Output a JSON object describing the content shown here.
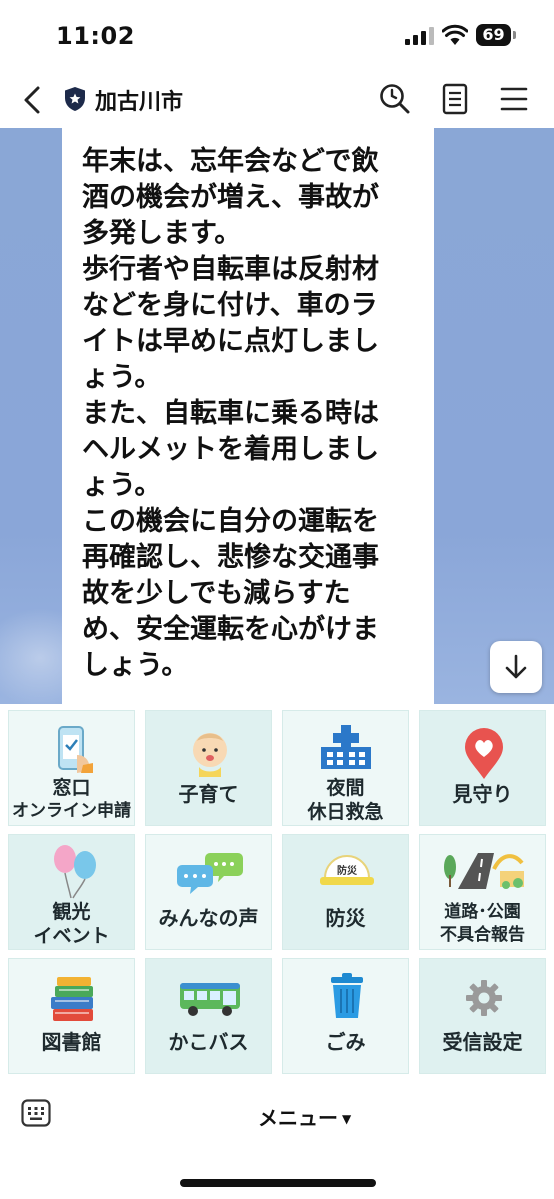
{
  "status_bar": {
    "time": "11:02",
    "battery": "69"
  },
  "header": {
    "title": "加古川市"
  },
  "chat": {
    "message_lines": [
      "年末は、忘年会などで飲",
      "酒の機会が増え、事故が",
      "多発します。",
      "歩行者や自転車は反射材",
      "などを身に付け、車のラ",
      "イトは早めに点灯しまし",
      "ょう。",
      "また、自転車に乗る時は",
      "ヘルメットを着用しまし",
      "ょう。",
      "この機会に自分の運転を",
      "再確認し、悲惨な交通事",
      "故を少しでも減らすた",
      "め、安全運転を心がけま",
      "しょう。"
    ]
  },
  "rich_menu": {
    "items": [
      {
        "lines": [
          "窓口",
          "オンライン申請"
        ],
        "icon": "phone-checklist-icon"
      },
      {
        "lines": [
          "子育て"
        ],
        "icon": "baby-icon"
      },
      {
        "lines": [
          "夜間",
          "休日救急"
        ],
        "icon": "hospital-icon"
      },
      {
        "lines": [
          "見守り"
        ],
        "icon": "heart-pin-icon"
      },
      {
        "lines": [
          "観光",
          "イベント"
        ],
        "icon": "balloons-icon"
      },
      {
        "lines": [
          "みんなの声"
        ],
        "icon": "speech-bubbles-icon"
      },
      {
        "lines": [
          "防災"
        ],
        "icon": "helmet-icon"
      },
      {
        "lines": [
          "道路･公園",
          "不具合報告"
        ],
        "icon": "road-park-icon"
      },
      {
        "lines": [
          "図書館"
        ],
        "icon": "books-icon"
      },
      {
        "lines": [
          "かこバス"
        ],
        "icon": "bus-icon"
      },
      {
        "lines": [
          "ごみ"
        ],
        "icon": "trash-bin-icon"
      },
      {
        "lines": [
          "受信設定"
        ],
        "icon": "gear-icon"
      }
    ]
  },
  "helmet_text": "防災",
  "bottom_bar": {
    "menu_label": "メニュー"
  },
  "colors": {
    "chat_background": "#8aa7d6",
    "tile": "#eef8f7",
    "tile_alt": "#dff1f0",
    "tile_border": "#d6ebe9"
  }
}
